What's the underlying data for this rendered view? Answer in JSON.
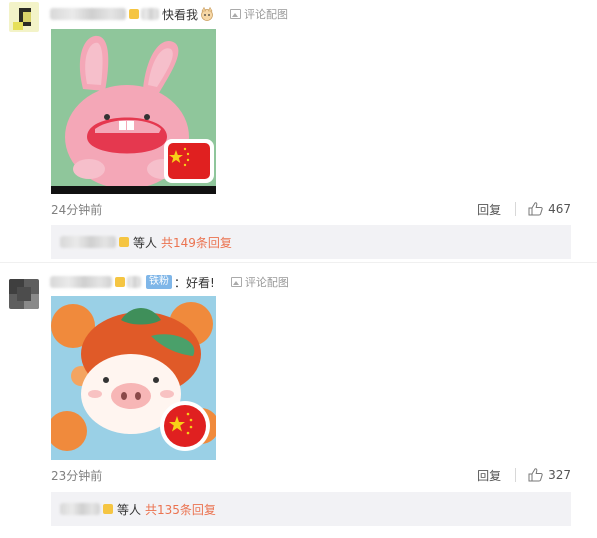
{
  "comments": [
    {
      "text": "快看我",
      "view_pic_label": "评论配图",
      "time": "24分钟前",
      "reply_label": "回复",
      "likes": "467",
      "sub_replies": {
        "etc_label": "等人",
        "total_label": "共149条回复"
      }
    },
    {
      "fans_badge": "铁粉",
      "colon": "：",
      "text": "好看!",
      "view_pic_label": "评论配图",
      "time": "23分钟前",
      "reply_label": "回复",
      "likes": "327",
      "sub_replies": {
        "etc_label": "等人",
        "total_label": "共135条回复"
      }
    }
  ],
  "colors": {
    "link_orange": "#eb7350",
    "muted_gray": "#808080",
    "subreply_bg": "#f2f2f5",
    "fans_badge_blue": "#7fb6e8"
  },
  "icons": [
    "picture-icon",
    "thumbs-up-icon",
    "china-flag-icon"
  ]
}
